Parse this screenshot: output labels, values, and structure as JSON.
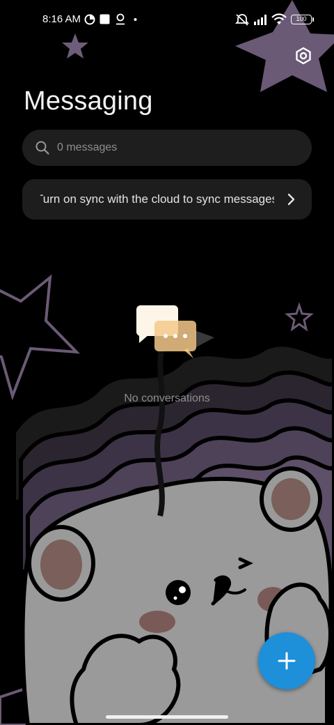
{
  "status_bar": {
    "time": "8:16 AM",
    "battery": "100",
    "left_icons": [
      "data-saver-icon",
      "notification-square-icon",
      "location-pin-icon",
      "dot-icon"
    ],
    "right_icons": [
      "mute-icon",
      "signal-icon",
      "wifi-icon",
      "battery-icon"
    ]
  },
  "header": {
    "title": "Messaging",
    "settings_icon": "settings-gear-icon"
  },
  "search": {
    "placeholder": "0 messages"
  },
  "sync_banner": {
    "text": "Turn on sync with the cloud to sync messages"
  },
  "empty_state": {
    "text": "No conversations"
  },
  "fab": {
    "icon": "plus-icon"
  },
  "colors": {
    "accent": "#1e8fd9",
    "card": "#1e1e1e",
    "wallpaper_star": "#6d5a78"
  }
}
